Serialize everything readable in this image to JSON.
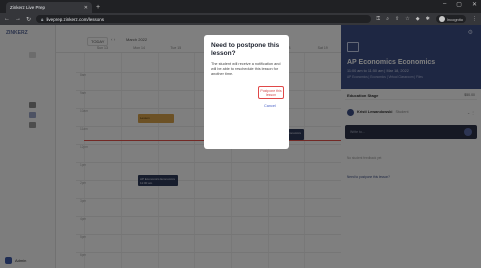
{
  "browser": {
    "tab_title": "Zinkerz Live Prep",
    "url": "liveprep.zinkerz.com/lessons",
    "incognito_label": "Incognito"
  },
  "app": {
    "logo_text": "ZINKERZ",
    "user_name": "Admin"
  },
  "calendar": {
    "today_label": "TODAY",
    "nav_arrows": "‹ ›",
    "date_range": "March 2022",
    "columns": [
      "Sun 13",
      "Mon 14",
      "Tue 15",
      "Wed 16",
      "Thu 17",
      "Fri 18",
      "Sat 19"
    ],
    "hours": [
      "8am",
      "9am",
      "10am",
      "11am",
      "12pm",
      "1pm",
      "2pm",
      "3pm",
      "4pm",
      "5pm",
      "6pm"
    ],
    "events": [
      {
        "text": "AP Economics Economics 11:00 am"
      },
      {
        "text": "AP Economics Economics 11:00 am"
      },
      {
        "text": "Lesson"
      }
    ]
  },
  "side_panel": {
    "title": "AP Economics Economics",
    "when": "11:00 am to 11:50 am | Mar 18, 2022",
    "meta": "AP Economics | Economics | Virtual Classroom | Files",
    "section_title": "Education Stage",
    "section_amount": "$50.00",
    "student_name": "Kristi Lewandowski",
    "student_role": "Student",
    "input_placeholder": "Write to...",
    "note": "No student feedback yet",
    "link": "Need to postpone this lesson?"
  },
  "modal": {
    "title": "Need to postpone this lesson?",
    "body": "The student will receive a notification and will be able to reschedule this lesson for another time.",
    "confirm_label": "Postpone this lesson",
    "cancel_label": "Cancel"
  },
  "colors": {
    "brand": "#3c4e86",
    "danger": "#e04848",
    "link": "#4b63c7"
  }
}
